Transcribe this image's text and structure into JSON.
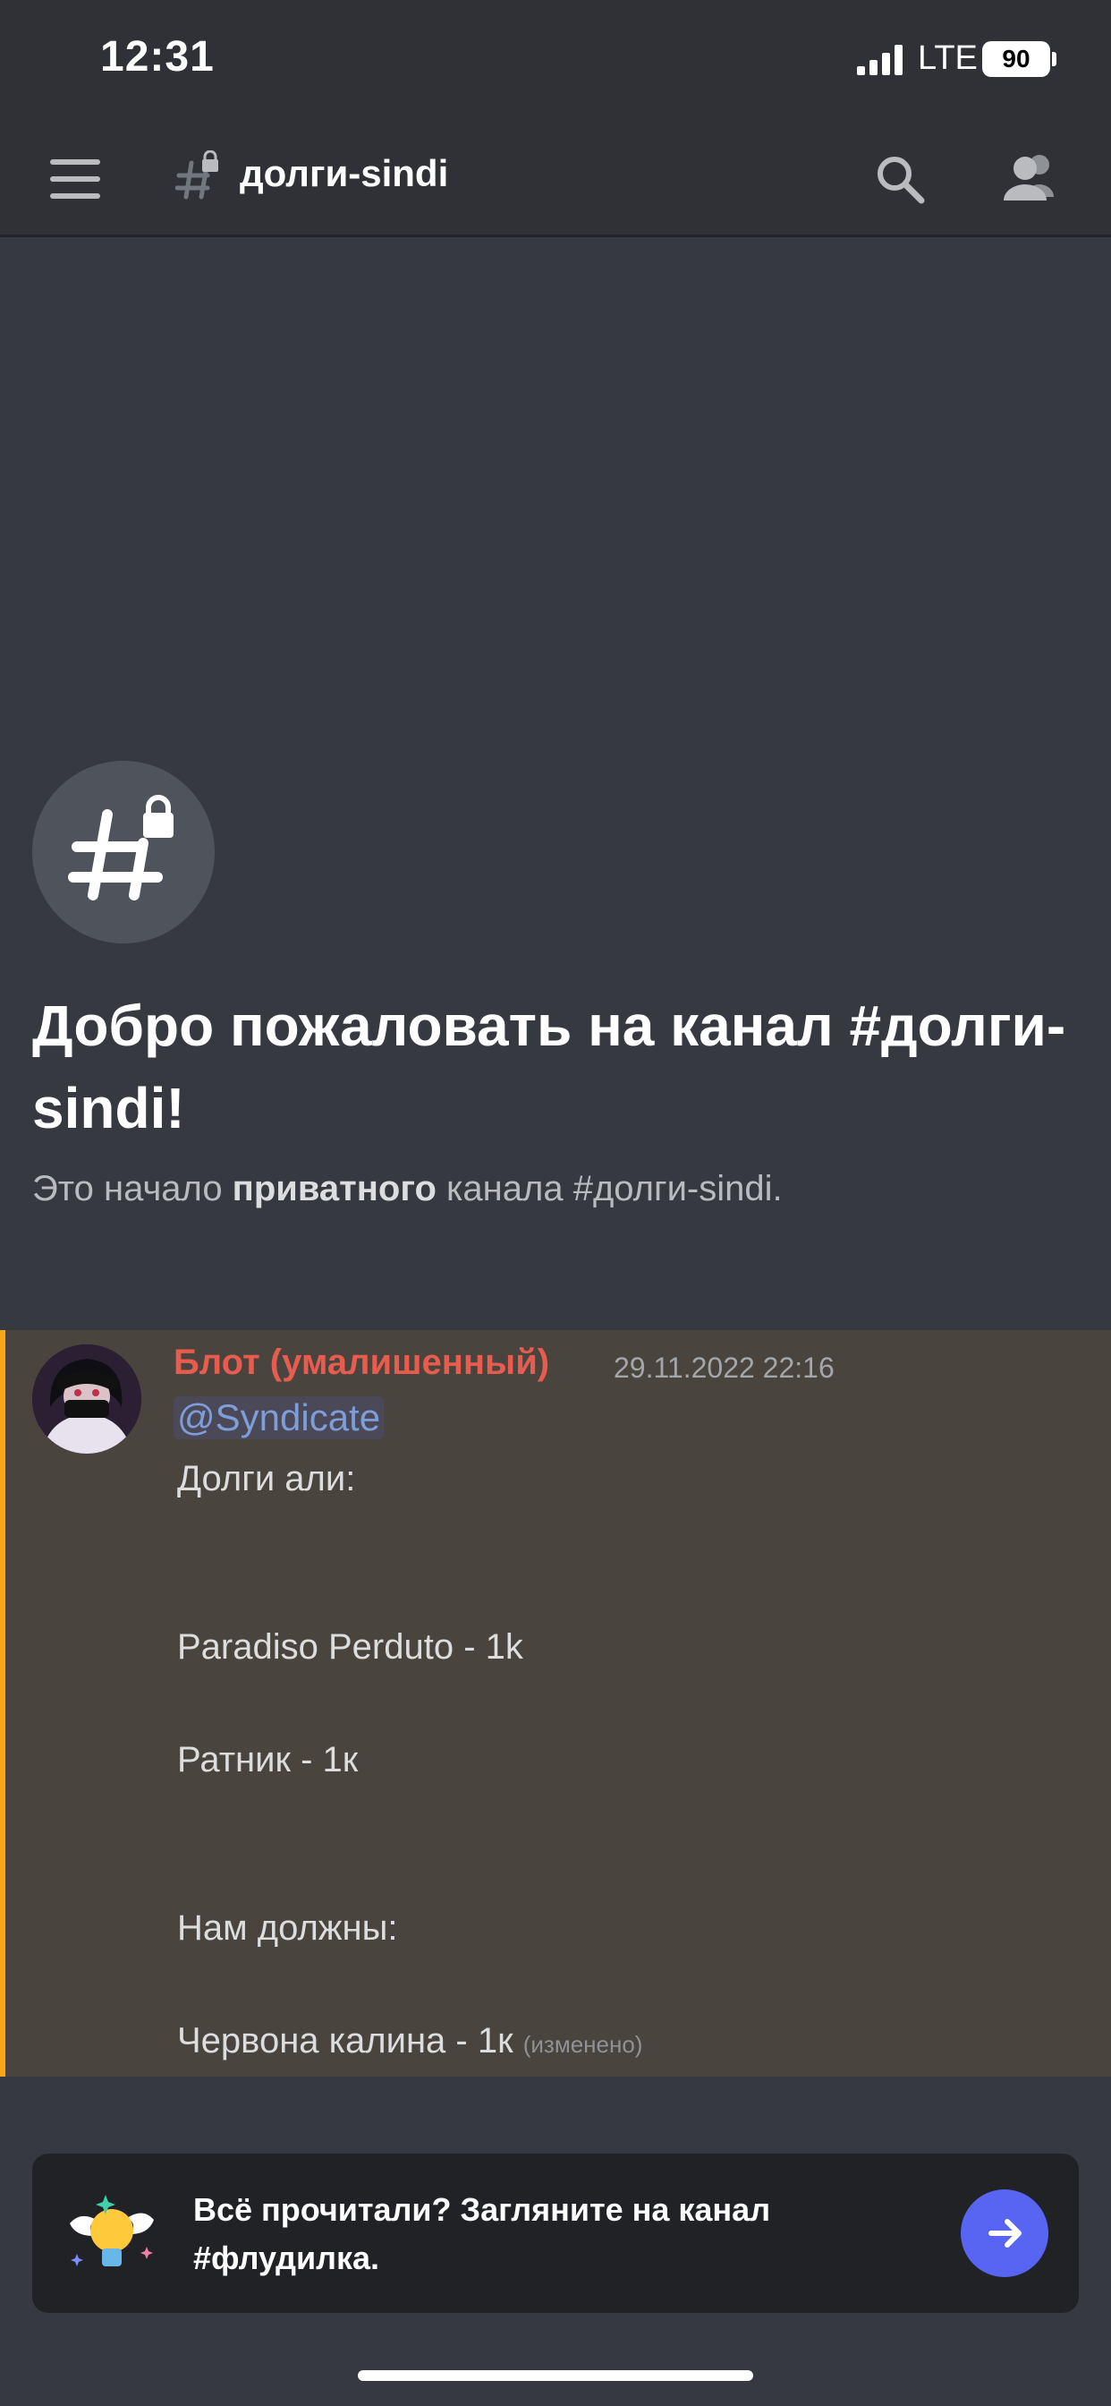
{
  "status_bar": {
    "time": "12:31",
    "network": "LTE",
    "battery": "90"
  },
  "header": {
    "channel_name": "долги-sindi"
  },
  "welcome": {
    "title": "Добро пожаловать на канал #долги-sindi!",
    "subtitle_prefix": "Это начало ",
    "subtitle_bold": "приватного",
    "subtitle_suffix": " канала #долги-sindi."
  },
  "message": {
    "author": "Блот (умалишенный)",
    "timestamp": "29.11.2022 22:16",
    "mention": "@Syndicate",
    "lines": [
      "Долги али:",
      "Paradiso Perduto - 1k",
      "Ратник - 1к",
      "Нам должны:",
      "Червона калина - 1к"
    ],
    "edited": "(изменено)"
  },
  "banner": {
    "text": "Всё прочитали? Загляните на канал #флудилка."
  },
  "colors": {
    "accent": "#5865f2",
    "author": "#e75c4f",
    "highlight_bar": "#faa61a"
  }
}
